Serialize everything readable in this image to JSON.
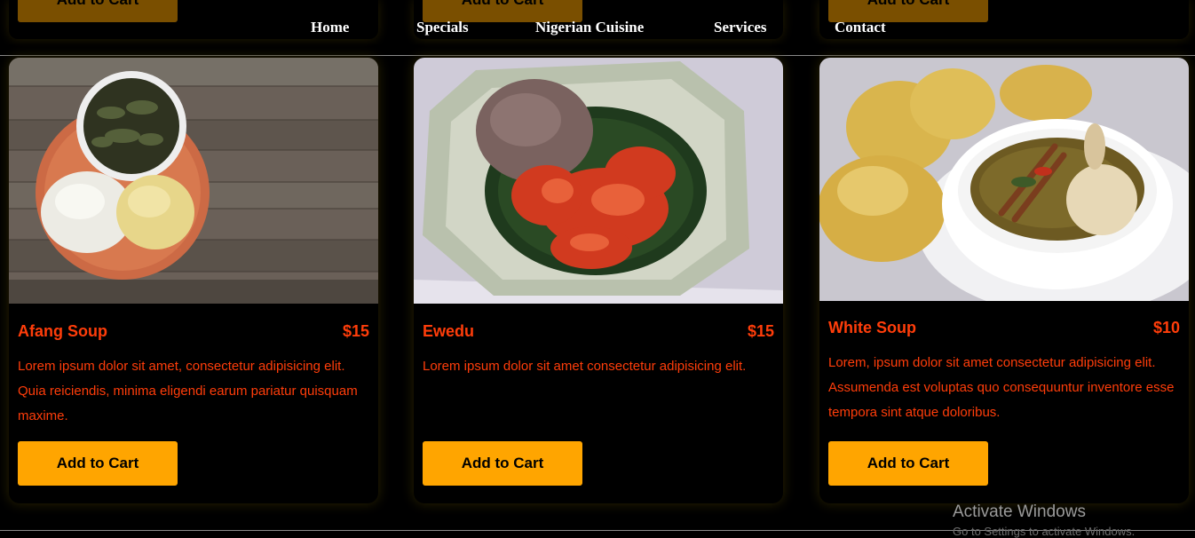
{
  "nav": {
    "items": [
      {
        "label": "Home"
      },
      {
        "label": "Specials"
      },
      {
        "label": "Nigerian Cuisine"
      },
      {
        "label": "Services"
      },
      {
        "label": "Contact"
      }
    ]
  },
  "partial_row": {
    "buttons": [
      {
        "label": "Add to Cart"
      },
      {
        "label": "Add to Cart"
      },
      {
        "label": "Add to Cart"
      }
    ]
  },
  "cards": [
    {
      "name": "Afang Soup",
      "price": "$15",
      "description": "Lorem ipsum dolor sit amet, consectetur adipisicing elit. Quia reiciendis, minima eligendi earum pariatur quisquam maxime.",
      "button": "Add to Cart"
    },
    {
      "name": "Ewedu",
      "price": "$15",
      "description": "Lorem ipsum dolor sit amet consectetur adipisicing elit.",
      "button": "Add to Cart"
    },
    {
      "name": "White Soup",
      "price": "$10",
      "description": "Lorem, ipsum dolor sit amet consectetur adipisicing elit. Assumenda est voluptas quo consequuntur inventore esse tempora sint atque doloribus.",
      "button": "Add to Cart"
    }
  ],
  "watermark": {
    "title": "Activate Windows",
    "subtitle": "Go to Settings to activate Windows."
  },
  "colors": {
    "accent": "#ffa500",
    "text_accent": "#ff3d0a",
    "background": "#000000"
  }
}
